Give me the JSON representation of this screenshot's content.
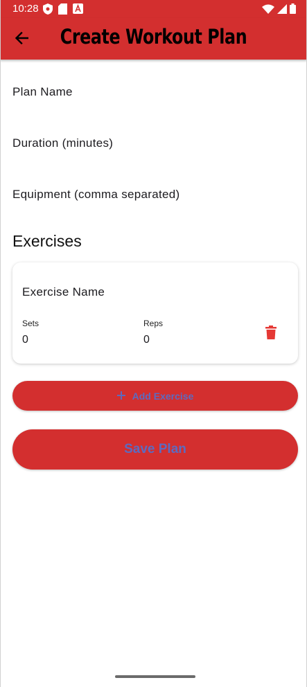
{
  "status_bar": {
    "time": "10:28",
    "icons_left": [
      "shield-icon",
      "sd-card-icon",
      "font-a-icon"
    ],
    "icons_right": [
      "wifi-icon",
      "signal-icon",
      "battery-icon"
    ]
  },
  "app_bar": {
    "title": "Create Workout Plan",
    "back_icon": "arrow-back-icon",
    "color": "#d32f2f"
  },
  "form": {
    "plan_name_placeholder": "Plan Name",
    "duration_placeholder": "Duration (minutes)",
    "equipment_placeholder": "Equipment (comma separated)"
  },
  "exercises": {
    "section_title": "Exercises",
    "items": [
      {
        "name_placeholder": "Exercise Name",
        "sets_label": "Sets",
        "sets_value": "0",
        "reps_label": "Reps",
        "reps_value": "0",
        "delete_icon": "trash-icon"
      }
    ]
  },
  "actions": {
    "add_exercise_label": "Add Exercise",
    "add_icon": "plus-icon",
    "save_label": "Save Plan",
    "button_text_color": "#5c6bc0"
  }
}
